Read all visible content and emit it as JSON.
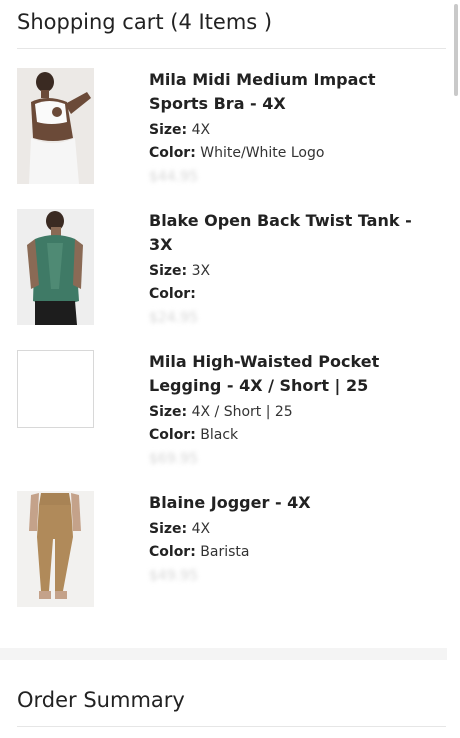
{
  "cart": {
    "title": "Shopping cart (4 Items )"
  },
  "items": [
    {
      "title": "Mila Midi Medium Impact Sports Bra - 4X",
      "size_label": "Size:",
      "size": "4X",
      "color_label": "Color:",
      "color": "White/White Logo",
      "image_icon": "product-image-sports-bra",
      "price": "$44.95"
    },
    {
      "title": "Blake Open Back Twist Tank - 3X",
      "size_label": "Size:",
      "size": "3X",
      "color_label": "Color:",
      "color": "",
      "image_icon": "product-image-tank",
      "price": "$24.95"
    },
    {
      "title": "Mila High-Waisted Pocket Legging - 4X / Short | 25",
      "size_label": "Size:",
      "size": "4X / Short | 25",
      "color_label": "Color:",
      "color": "Black",
      "image_icon": "product-image-placeholder",
      "price": "$69.95"
    },
    {
      "title": "Blaine Jogger - 4X",
      "size_label": "Size:",
      "size": "4X",
      "color_label": "Color:",
      "color": "Barista",
      "image_icon": "product-image-jogger",
      "price": "$49.95"
    }
  ],
  "summary": {
    "title": "Order Summary"
  },
  "colors": {
    "text": "#222222",
    "divider": "#e6e6e6",
    "band": "#f4f4f4",
    "tank_green": "#3f7a66",
    "jogger_tan": "#b08a5a"
  }
}
